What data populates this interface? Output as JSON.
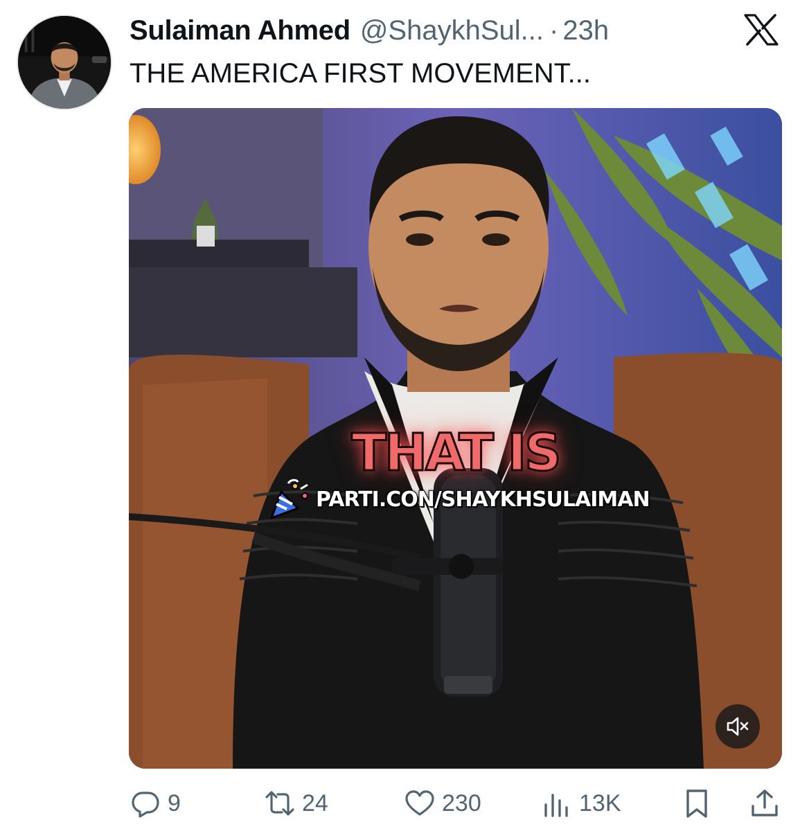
{
  "author": {
    "display_name": "Sulaiman Ahmed",
    "handle": "@ShaykhSul...",
    "separator": "·",
    "time": "23h",
    "avatar_icon": "profile-photo"
  },
  "platform_icon": "x-logo-icon",
  "tweet": {
    "text": "THE AMERICA FIRST MOVEMENT..."
  },
  "media": {
    "type": "video",
    "caption_overlay": "THAT IS",
    "watermark": "PARTI.CON/SHAYKHSULAIMAN",
    "mute_icon": "volume-muted-icon"
  },
  "actions": {
    "replies": "9",
    "reposts": "24",
    "likes": "230",
    "views": "13K"
  },
  "colors": {
    "text_primary": "#0f1419",
    "text_secondary": "#536471",
    "caption": "#f06a6a"
  }
}
